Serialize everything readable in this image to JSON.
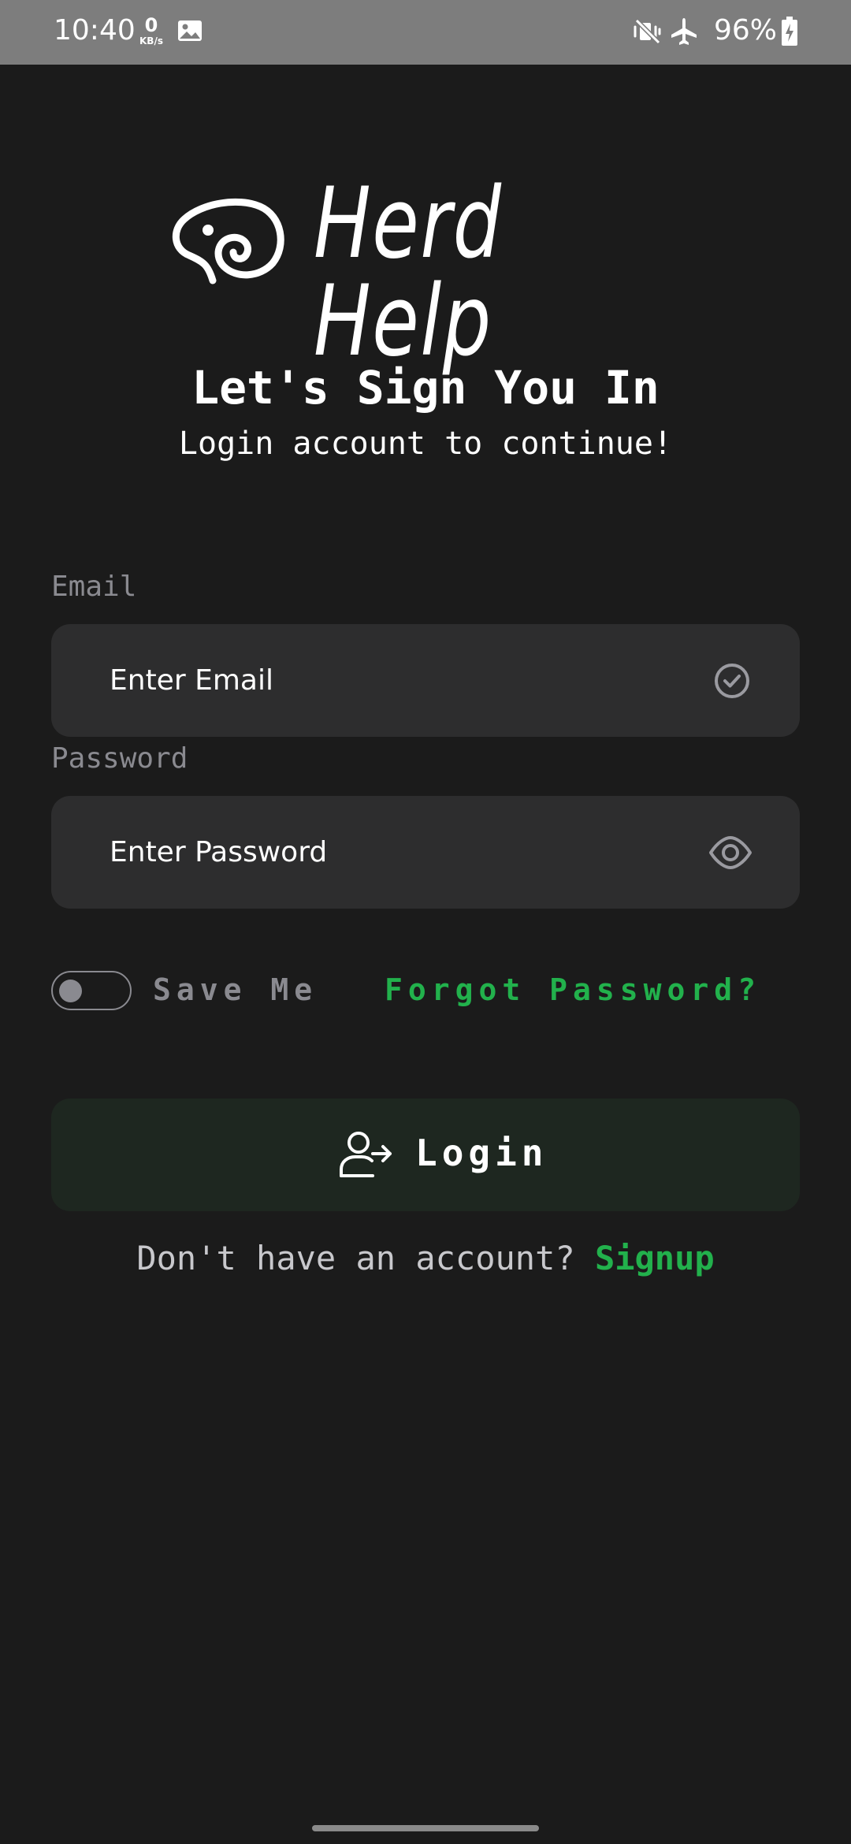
{
  "status_bar": {
    "time": "10:40",
    "net_speed_value": "0",
    "net_speed_unit": "KB/s",
    "battery": "96%",
    "icons": [
      "image-icon",
      "mute-vibrate-icon",
      "airplane-icon",
      "battery-charging-icon"
    ]
  },
  "logo": {
    "text": "Herd Help"
  },
  "header": {
    "title": "Let's Sign You In",
    "subtitle": "Login account to continue!"
  },
  "form": {
    "email_label": "Email",
    "email_placeholder": "Enter Email",
    "password_label": "Password",
    "password_placeholder": "Enter Password"
  },
  "options": {
    "save_me_label": "Save Me",
    "save_me_checked": false,
    "forgot_password": "Forgot Password?"
  },
  "login_button": {
    "label": "Login"
  },
  "signup": {
    "prompt": "Don't have an account?",
    "link": "Signup"
  },
  "colors": {
    "background": "#1b1b1b",
    "field": "#2d2d2e",
    "accent_green": "#22b14c",
    "login_button": "#1e2720",
    "muted": "#8a8a90"
  }
}
